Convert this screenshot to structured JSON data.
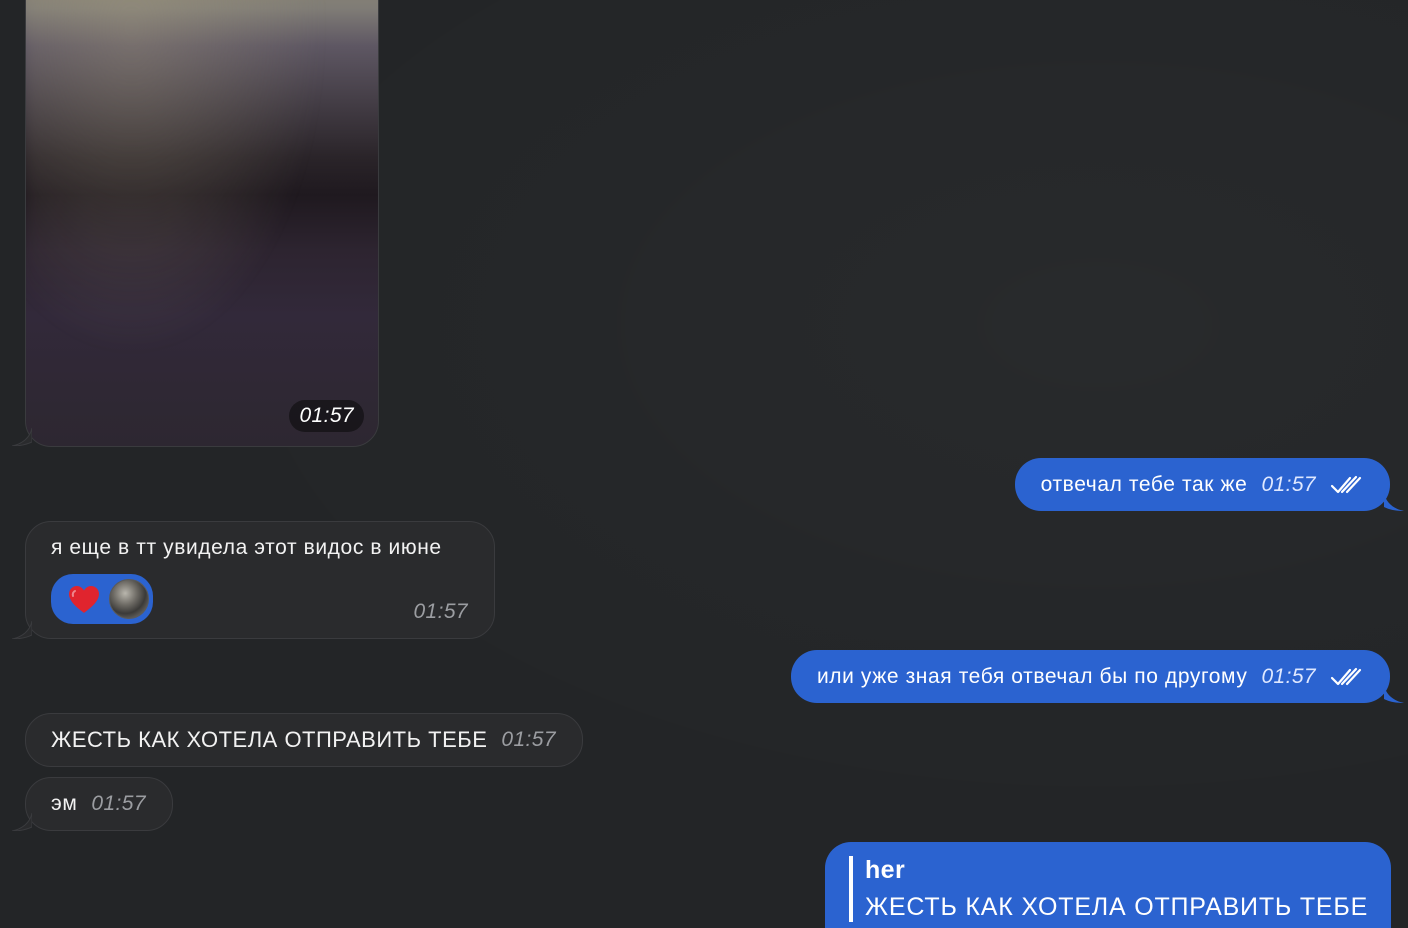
{
  "messages": {
    "video": {
      "time": "01:57"
    },
    "out1": {
      "text": "отвечал тебе так же",
      "time": "01:57",
      "status_icon": "double-check-icon"
    },
    "in1": {
      "text": "я еще в тт увидела этот видос в июне",
      "time": "01:57",
      "reaction_icon": "heart-icon"
    },
    "out2": {
      "text": "или уже зная тебя отвечал бы по другому",
      "time": "01:57",
      "status_icon": "double-check-icon"
    },
    "in2": {
      "text": "ЖЕСТЬ КАК ХОТЕЛА ОТПРАВИТЬ ТЕБЕ",
      "time": "01:57"
    },
    "in3": {
      "text": "эм",
      "time": "01:57"
    },
    "out3": {
      "reply_name": "her",
      "reply_text": "ЖЕСТЬ КАК ХОТЕЛА ОТПРАВИТЬ ТЕБЕ"
    }
  },
  "colors": {
    "background": "#232527",
    "incoming_bubble": "#2a2b2d",
    "outgoing_bubble": "#2b63d0",
    "reaction_heart": "#e0242e"
  }
}
